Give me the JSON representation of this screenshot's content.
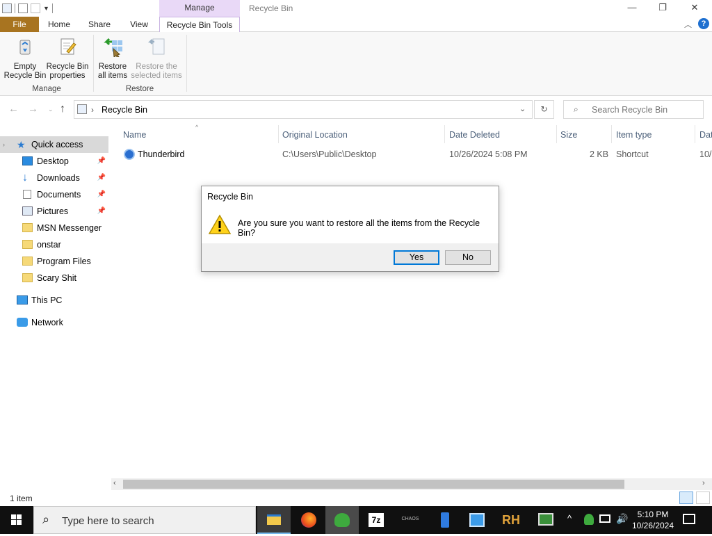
{
  "window": {
    "title": "Recycle Bin",
    "context_tab_header": "Manage",
    "minimize": "—",
    "restore": "❐",
    "close": "✕",
    "help": "?"
  },
  "ribbon": {
    "tabs": [
      "File",
      "Home",
      "Share",
      "View",
      "Recycle Bin Tools"
    ],
    "buttons": {
      "empty_recycle_bin": [
        "Empty",
        "Recycle Bin"
      ],
      "recycle_bin_properties": [
        "Recycle Bin",
        "properties"
      ],
      "restore_all_items": [
        "Restore",
        "all items"
      ],
      "restore_selected_items": [
        "Restore the",
        "selected items"
      ]
    },
    "groups": {
      "manage": "Manage",
      "restore": "Restore"
    }
  },
  "address": {
    "path": "Recycle Bin",
    "search_placeholder": "Search Recycle Bin"
  },
  "sidebar": {
    "quick_access": "Quick access",
    "items": [
      {
        "label": "Desktop",
        "pinned": true
      },
      {
        "label": "Downloads",
        "pinned": true
      },
      {
        "label": "Documents",
        "pinned": true
      },
      {
        "label": "Pictures",
        "pinned": true
      },
      {
        "label": "MSN Messenger",
        "pinned": false
      },
      {
        "label": "onstar",
        "pinned": false
      },
      {
        "label": "Program Files",
        "pinned": false
      },
      {
        "label": "Scary Shit",
        "pinned": false
      }
    ],
    "this_pc": "This PC",
    "network": "Network"
  },
  "file_list": {
    "columns": [
      "Name",
      "Original Location",
      "Date Deleted",
      "Size",
      "Item type",
      "Dat"
    ],
    "rows": [
      {
        "name": "Thunderbird",
        "original_location": "C:\\Users\\Public\\Desktop",
        "date_deleted": "10/26/2024 5:08 PM",
        "size": "2 KB",
        "item_type": "Shortcut",
        "overflow": "10/"
      }
    ]
  },
  "status": {
    "item_count": "1 item"
  },
  "dialog": {
    "title": "Recycle Bin",
    "message": "Are you sure you want to restore all the items from the Recycle Bin?",
    "yes": "Yes",
    "no": "No"
  },
  "taskbar": {
    "search_placeholder": "Type here to search",
    "time": "5:10 PM",
    "date": "10/26/2024",
    "apps": [
      "file-explorer",
      "firefox",
      "msn-messenger",
      "7zip",
      "chaos",
      "usb-tool",
      "photo-viewer",
      "rh",
      "cmd"
    ]
  },
  "colors": {
    "file_tab": "#a87420",
    "context_tab": "#e9d9f7",
    "selection": "#cce8ff",
    "accent": "#0078d7",
    "taskbar": "#101010"
  }
}
